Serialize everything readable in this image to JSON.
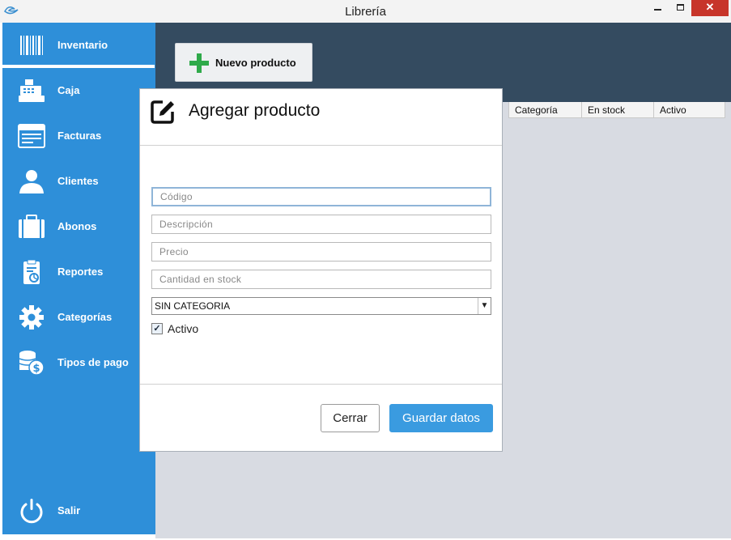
{
  "window": {
    "title": "Librería",
    "close_glyph": "✕"
  },
  "sidebar": {
    "items": [
      {
        "label": "Inventario",
        "icon": "barcode-icon",
        "active": true
      },
      {
        "label": "Caja",
        "icon": "cash-register-icon"
      },
      {
        "label": "Facturas",
        "icon": "invoice-icon"
      },
      {
        "label": "Clientes",
        "icon": "user-icon"
      },
      {
        "label": "Abonos",
        "icon": "briefcase-icon"
      },
      {
        "label": "Reportes",
        "icon": "report-clipboard-icon"
      },
      {
        "label": "Categorías",
        "icon": "gear-icon"
      },
      {
        "label": "Tipos de pago",
        "icon": "coins-dollar-icon"
      }
    ],
    "exit": {
      "label": "Salir",
      "icon": "power-icon"
    }
  },
  "toolbar": {
    "new_product_label": "Nuevo producto"
  },
  "table": {
    "columns": [
      "Categoría",
      "En stock",
      "Activo"
    ]
  },
  "dialog": {
    "title": "Agregar producto",
    "fields": {
      "code_placeholder": "Código",
      "description_placeholder": "Descripción",
      "price_placeholder": "Precio",
      "stock_placeholder": "Cantidad en stock"
    },
    "category_selected": "SIN CATEGORIA",
    "active_label": "Activo",
    "active_checked": true,
    "close_label": "Cerrar",
    "save_label": "Guardar datos"
  },
  "colors": {
    "sidebar": "#2e8fd9",
    "header_band": "#344b60",
    "main_bg": "#d8dbe2",
    "primary_button": "#3a9be0",
    "plus_icon": "#2faa4a"
  }
}
